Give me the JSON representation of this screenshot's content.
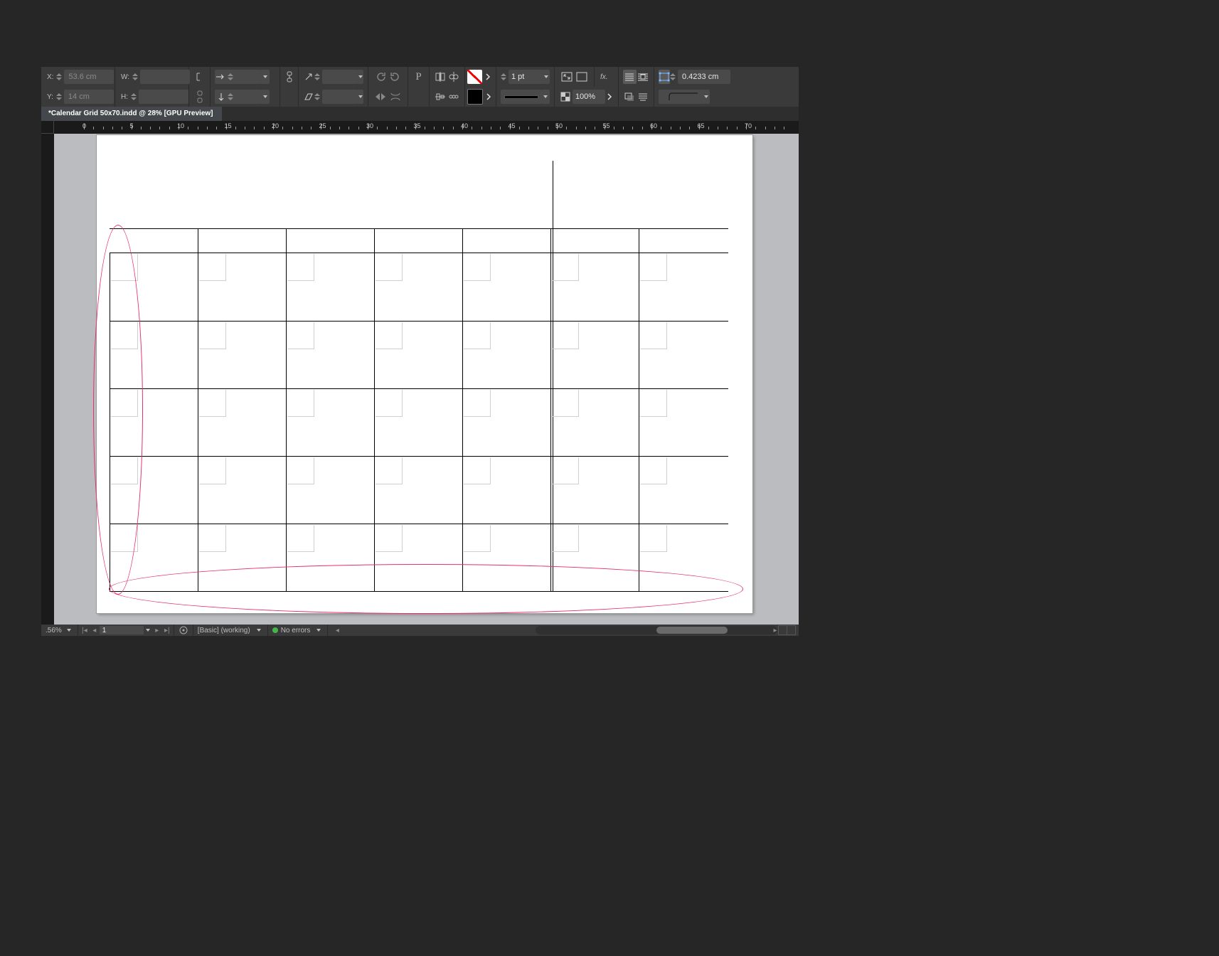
{
  "tab": {
    "title": "*Calendar Grid 50x70.indd @ 28% [GPU Preview]"
  },
  "coords": {
    "x_label": "X:",
    "x_value": "53.6 cm",
    "y_label": "Y:",
    "y_value": "14 cm",
    "w_label": "W:",
    "w_value": "",
    "h_label": "H:",
    "h_value": ""
  },
  "rotate_label": "",
  "shear_label": "",
  "stroke": {
    "weight": "1 pt",
    "corner_value": "0.4233 cm"
  },
  "opacity": {
    "value": "100%"
  },
  "ruler": {
    "majors": [
      0,
      5,
      10,
      15,
      20,
      25,
      30,
      35,
      40,
      45,
      50,
      55,
      60,
      65,
      70
    ]
  },
  "status": {
    "zoom": ".56%",
    "page": "1",
    "style_label": "[Basic] (working)",
    "errors_label": "No errors"
  },
  "fx_label": "fx."
}
